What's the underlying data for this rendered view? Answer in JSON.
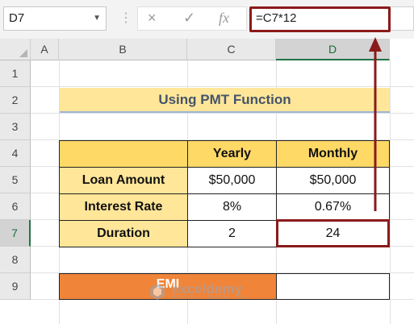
{
  "name_box": {
    "value": "D7",
    "dropdown_icon": "chevron-down-icon"
  },
  "formula_bar": {
    "separator": "⋮",
    "cancel_icon": "×",
    "confirm_icon": "✓",
    "function_icon": "fx",
    "formula": "=C7*12"
  },
  "columns": [
    "A",
    "B",
    "C",
    "D"
  ],
  "rows": [
    "1",
    "2",
    "3",
    "4",
    "5",
    "6",
    "7",
    "8",
    "9"
  ],
  "sheet": {
    "title": "Using PMT Function",
    "table": {
      "headers": [
        "",
        "Yearly",
        "Monthly"
      ],
      "rows": [
        {
          "label": "Loan Amount",
          "yearly": "$50,000",
          "monthly": "$50,000"
        },
        {
          "label": "Interest Rate",
          "yearly": "8%",
          "monthly": "0.67%"
        },
        {
          "label": "Duration",
          "yearly": "2",
          "monthly": "24"
        }
      ]
    },
    "emi_label": "EMI",
    "emi_value": ""
  },
  "watermark": {
    "brand": "exceldemy",
    "tagline": "EXCEL · DATA · BI"
  },
  "colors": {
    "title_fill": "#ffe699",
    "header_fill": "#ffd966",
    "emi_fill": "#f08438",
    "highlight": "#8b1a1a",
    "selected_header": "#217346"
  }
}
